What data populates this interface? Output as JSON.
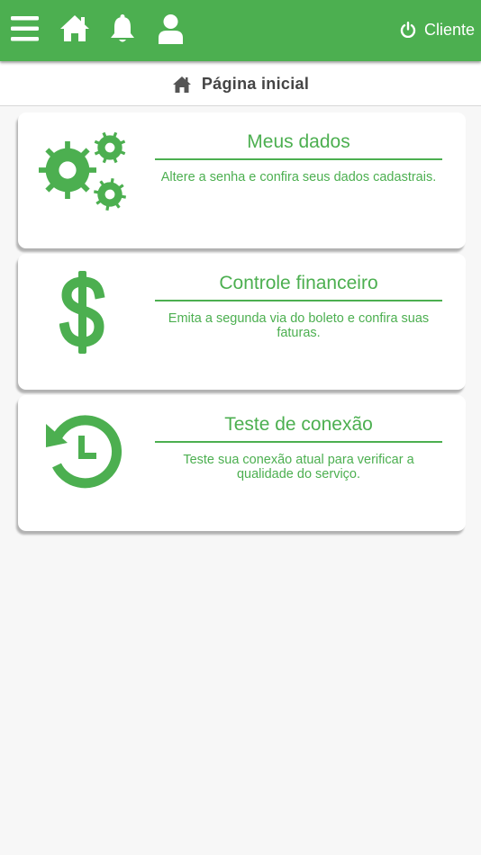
{
  "colors": {
    "primary": "#4caf50",
    "text_dark": "#444444",
    "background": "#f7f7f7"
  },
  "header": {
    "icons": [
      "menu-icon",
      "home-icon",
      "bell-icon",
      "user-icon"
    ],
    "user_label": "Cliente",
    "user_icon": "power-icon"
  },
  "page": {
    "title": "Página inicial",
    "icon": "home-icon"
  },
  "cards": [
    {
      "icon": "gears-icon",
      "title": "Meus dados",
      "description": "Altere a senha e confira seus dados cadastrais."
    },
    {
      "icon": "dollar-icon",
      "title": "Controle financeiro",
      "description": "Emita a segunda via do boleto e confira suas faturas."
    },
    {
      "icon": "history-icon",
      "title": "Teste de conexão",
      "description": "Teste sua conexão atual para verificar a qualidade do serviço."
    }
  ]
}
